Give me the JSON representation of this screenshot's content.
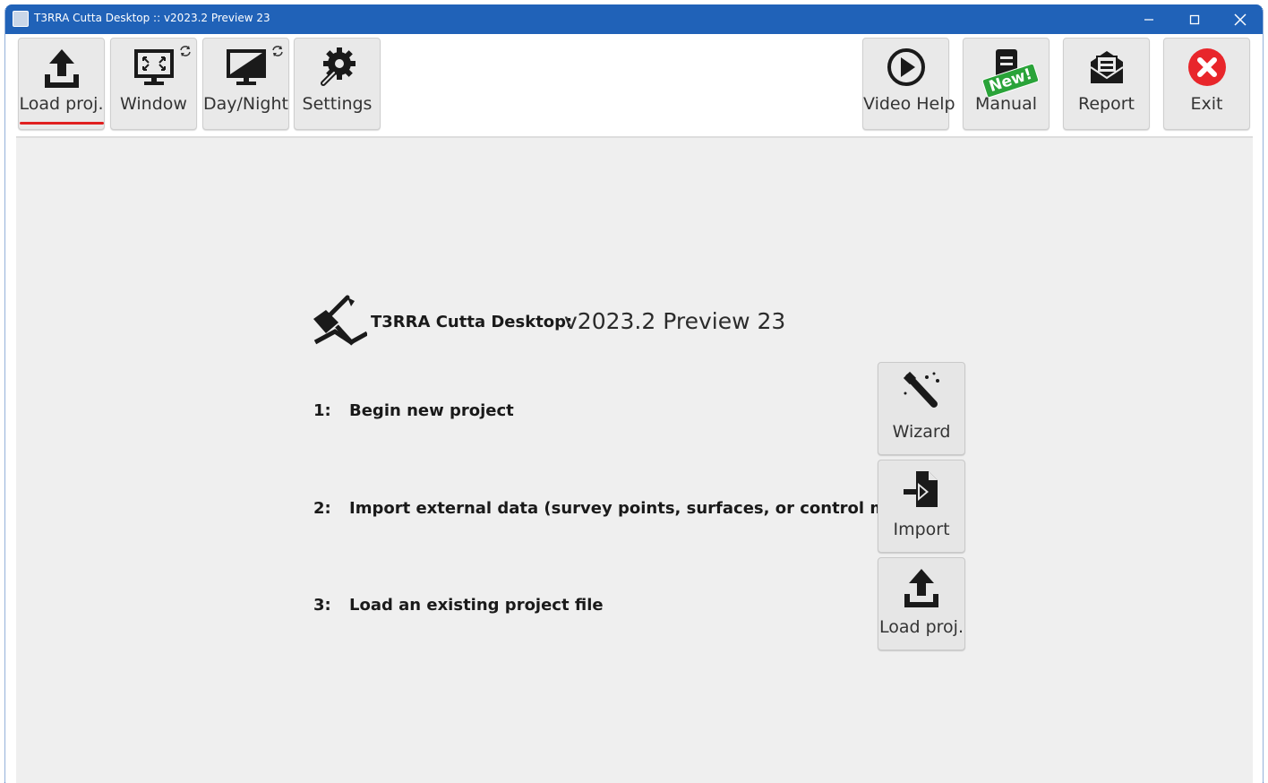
{
  "window": {
    "title": "T3RRA Cutta Desktop :: v2023.2 Preview 23",
    "minimize_label": "–",
    "maximize_label": "☐",
    "close_label": "✕"
  },
  "toolbar": {
    "left": [
      {
        "label": "Load proj.",
        "icon": "upload-icon",
        "active": true
      },
      {
        "label": "Window",
        "icon": "monitor-fullscreen-icon"
      },
      {
        "label": "Day/Night",
        "icon": "monitor-daynight-icon"
      },
      {
        "label": "Settings",
        "icon": "gear-wrench-icon"
      }
    ],
    "right": [
      {
        "label": "Video Help",
        "icon": "play-circle-icon"
      },
      {
        "label": "Manual",
        "icon": "manual-icon",
        "badge": "New!"
      },
      {
        "label": "Report",
        "icon": "report-envelope-icon"
      },
      {
        "label": "Exit",
        "icon": "exit-icon"
      }
    ]
  },
  "main": {
    "brand_label": "T3RRA Cutta Desktop:",
    "version": "v2023.2 Preview 23",
    "steps": [
      {
        "num": "1:",
        "text": "Begin new project",
        "button": "Wizard",
        "icon": "magic-wand-icon"
      },
      {
        "num": "2:",
        "text": "Import external data (survey points, surfaces, or control maps)",
        "button": "Import",
        "icon": "import-file-icon"
      },
      {
        "num": "3:",
        "text": "Load an existing project file",
        "button": "Load proj.",
        "icon": "upload-icon"
      }
    ]
  },
  "colors": {
    "titlebar": "#2062b8",
    "exit_red": "#e8262b",
    "badge_green": "#2aa339",
    "active_underline": "#e02020"
  }
}
